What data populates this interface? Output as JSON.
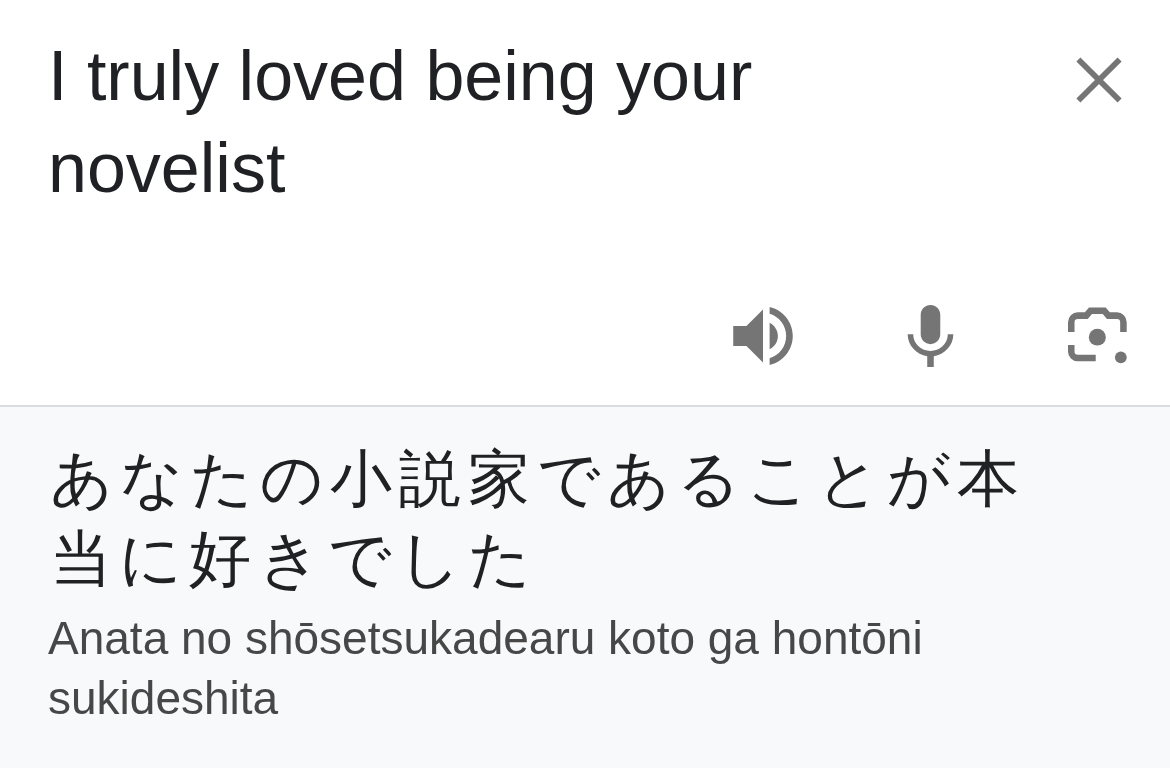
{
  "source": {
    "text": "I truly loved being your novelist"
  },
  "translation": {
    "text": "あなたの小説家であることが本当に好きでした",
    "romanization": "Anata no shōsetsukadearu koto ga hontōni sukideshita"
  }
}
